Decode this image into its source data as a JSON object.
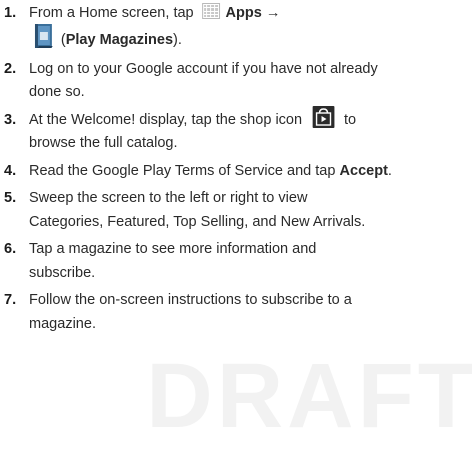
{
  "steps": [
    {
      "num": "1.",
      "line1_pre": "From a Home screen, tap",
      "line1_bold": "Apps →",
      "line2_bold": "Play Magazines",
      "line2_open": "(",
      "line2_close": ")."
    },
    {
      "num": "2.",
      "line1": "Log on to your Google account if you have not already",
      "line2": "done so."
    },
    {
      "num": "3.",
      "line1_pre": "At the Welcome! display, tap the shop icon",
      "line1_post": "to",
      "line2": "browse the full catalog."
    },
    {
      "num": "4.",
      "line1_pre": "Read the Google Play Terms of Service and tap",
      "line1_bold": "Accept",
      "line1_post": "."
    },
    {
      "num": "5.",
      "line1": "Sweep the screen to the left or right to view",
      "line2": "Categories, Featured, Top Selling, and New Arrivals."
    },
    {
      "num": "6.",
      "line1": "Tap a magazine to see more information and",
      "line2": "subscribe."
    },
    {
      "num": "7.",
      "line1": "Follow the on-screen instructions to subscribe to a",
      "line2": "magazine."
    }
  ],
  "icons": {
    "apps": "apps-grid-icon",
    "magazines": "play-magazines-icon",
    "shop": "play-store-shop-icon"
  },
  "colors": {
    "text": "#2a2a2a",
    "icon_dark": "#2b2b2b",
    "magazine_blue": "#3a6f9a"
  }
}
